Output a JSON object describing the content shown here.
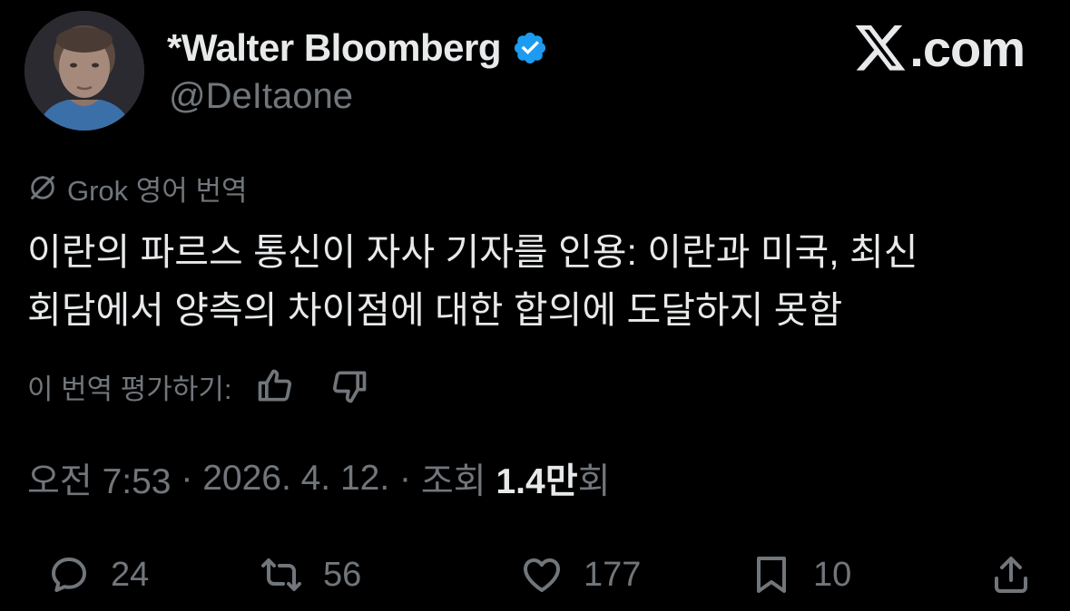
{
  "brand": {
    "text": ".com",
    "icon": "x-logo-icon"
  },
  "author": {
    "display_name": "*Walter Bloomberg",
    "handle": "@DeItaone",
    "verified": true,
    "verified_color": "#1d9bf0",
    "avatar": "avatar-photo"
  },
  "translation": {
    "label": "Grok 영어 번역",
    "icon": "grok-icon"
  },
  "tweet": {
    "text": "이란의 파르스 통신이 자사 기자를 인용: 이란과 미국, 최신 회담에서 양측의 차이점에 대한 합의에 도달하지 못함"
  },
  "rating": {
    "label": "이 번역 평가하기:",
    "like_icon": "thumbs-up-icon",
    "dislike_icon": "thumbs-down-icon"
  },
  "meta": {
    "time": "오전 7:53",
    "sep1": " · ",
    "date": "2026. 4. 12.",
    "sep2": " · ",
    "views_label": "조회 ",
    "views_number": "1.4만",
    "views_suffix": "회"
  },
  "actions": {
    "replies": "24",
    "reposts": "56",
    "likes": "177",
    "bookmarks": "10"
  },
  "colors": {
    "background": "#000000",
    "text_primary": "#e7e9ea",
    "text_secondary": "#71767b",
    "verified": "#1d9bf0"
  }
}
